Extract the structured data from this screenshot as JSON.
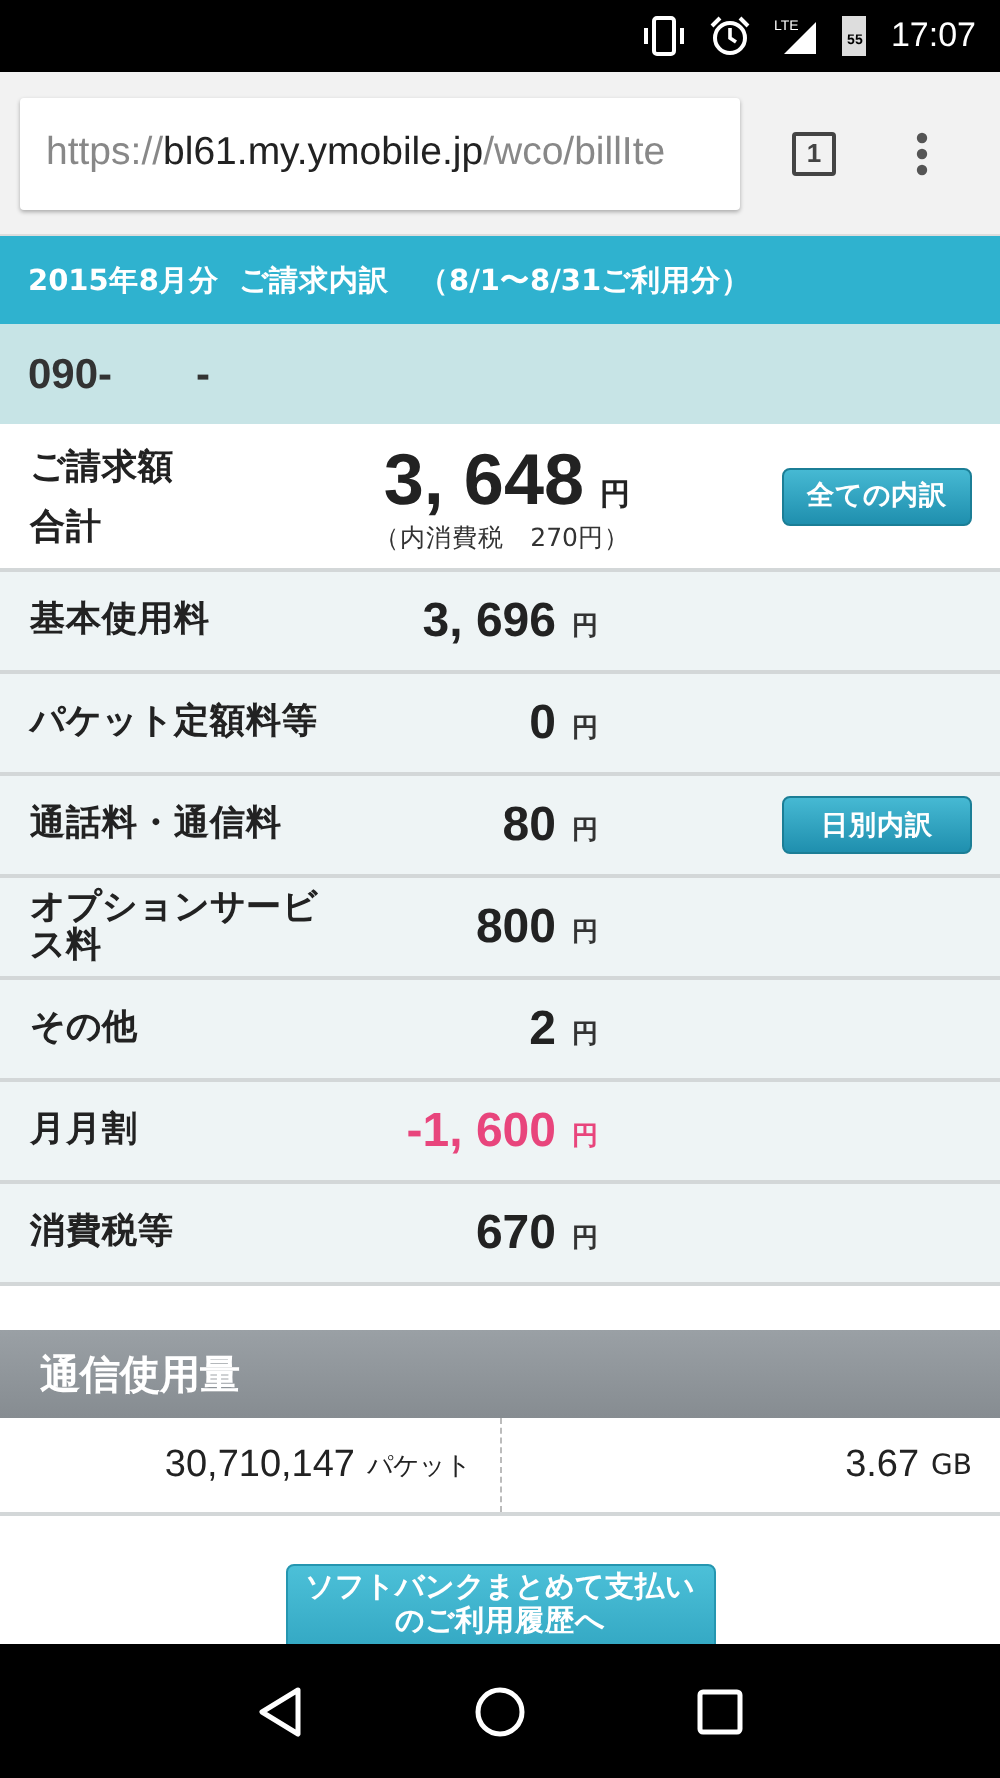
{
  "status_bar": {
    "network": "LTE",
    "battery": "55",
    "time": "17:07"
  },
  "browser": {
    "url": {
      "scheme": "https://",
      "host": "bl61.my.ymobile.jp",
      "path": "/wco/billIte"
    },
    "tab_count": "1"
  },
  "bill": {
    "title": "2015年8月分  ご請求内訳　（8/1〜8/31ご利用分）",
    "phone": "090-　　-",
    "total": {
      "label_lines": [
        "ご請求額",
        "合計"
      ],
      "value": "3, 648",
      "unit": "円",
      "tax_note": "（内消費税　270円）",
      "button": "全ての内訳"
    },
    "rows": [
      {
        "label": "基本使用料",
        "value": "3, 696",
        "unit": "円",
        "negative": false
      },
      {
        "label": "パケット定額料等",
        "value": "0",
        "unit": "円",
        "negative": false
      },
      {
        "label": "通話料・通信料",
        "value": "80",
        "unit": "円",
        "negative": false,
        "button": "日別内訳"
      },
      {
        "label": "オプションサービス料",
        "value": "800",
        "unit": "円",
        "negative": false
      },
      {
        "label": "その他",
        "value": "2",
        "unit": "円",
        "negative": false
      },
      {
        "label": "月月割",
        "value": "-1, 600",
        "unit": "円",
        "negative": true
      },
      {
        "label": "消費税等",
        "value": "670",
        "unit": "円",
        "negative": false
      }
    ]
  },
  "usage": {
    "title": "通信使用量",
    "packets": "30,710,147",
    "packets_unit": "パケット",
    "data": "3.67",
    "data_unit": "GB"
  },
  "history_button": [
    "ソフトバンクまとめて支払い",
    "のご利用履歴へ"
  ]
}
